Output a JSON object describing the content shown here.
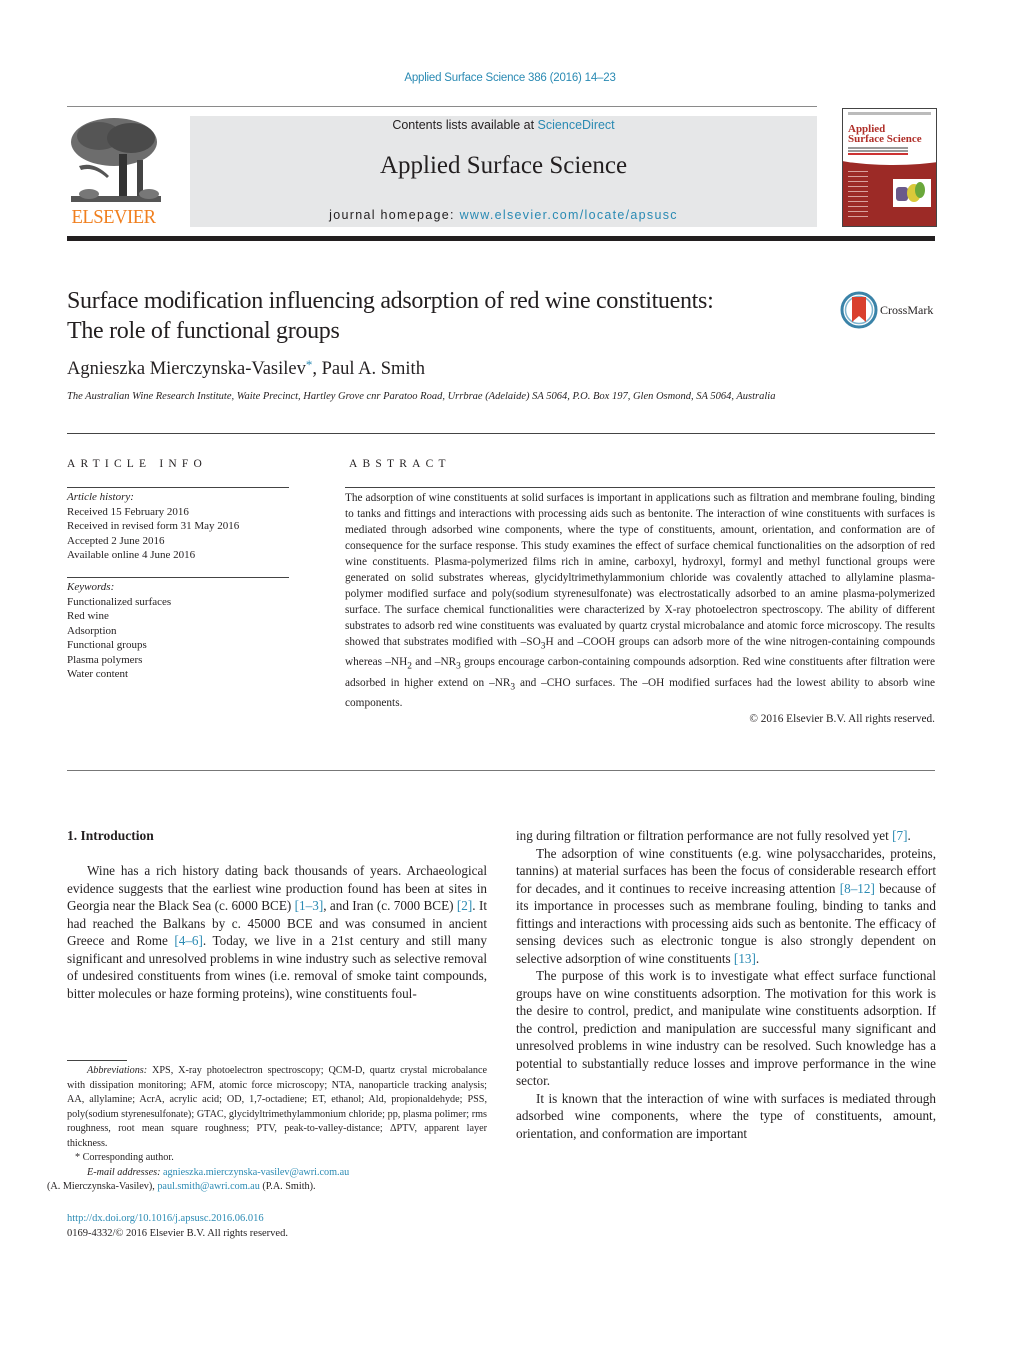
{
  "header": {
    "journal_ref": "Applied Surface Science 386 (2016) 14–23",
    "publisher_logo_text": "ELSEVIER",
    "contents_prefix": "Contents lists available at ",
    "contents_link": "ScienceDirect",
    "journal_title": "Applied Surface Science",
    "homepage_prefix": "journal homepage: ",
    "homepage_link": "www.elsevier.com/locate/apsusc",
    "cover_title_line1": "Applied",
    "cover_title_line2": "Surface Science"
  },
  "article": {
    "title_line1": "Surface modification influencing adsorption of red wine constituents:",
    "title_line2": "The role of functional groups",
    "crossmark_label": "CrossMark",
    "author1": "Agnieszka Mierczynska-Vasilev",
    "author1_mark": "*",
    "author_sep": ", ",
    "author2": "Paul A. Smith",
    "affiliation": "The Australian Wine Research Institute, Waite Precinct, Hartley Grove cnr Paratoo Road, Urrbrae (Adelaide) SA 5064, P.O. Box 197, Glen Osmond, SA 5064, Australia"
  },
  "article_info": {
    "heading": "ARTICLE INFO",
    "history_label": "Article history:",
    "history": [
      "Received 15 February 2016",
      "Received in revised form 31 May 2016",
      "Accepted 2 June 2016",
      "Available online 4 June 2016"
    ],
    "keywords_label": "Keywords:",
    "keywords": [
      "Functionalized surfaces",
      "Red wine",
      "Adsorption",
      "Functional groups",
      "Plasma polymers",
      "Water content"
    ]
  },
  "abstract": {
    "heading": "ABSTRACT",
    "text_part1": "The adsorption of wine constituents at solid surfaces is important in applications such as filtration and membrane fouling, binding to tanks and fittings and interactions with processing aids such as bentonite. The interaction of wine constituents with surfaces is mediated through adsorbed wine components, where the type of constituents, amount, orientation, and conformation are of consequence for the surface response. This study examines the effect of surface chemical functionalities on the adsorption of red wine constituents. Plasma-polymerized films rich in amine, carboxyl, hydroxyl, formyl and methyl functional groups were generated on solid substrates whereas, glycidyltrimethylammonium chloride was covalently attached to allylamine plasma-polymer modified surface and poly(sodium styrenesulfonate) was electrostatically adsorbed to an amine plasma-polymerized surface. The surface chemical functionalities were characterized by X-ray photoelectron spectroscopy. The ability of different substrates to adsorb red wine constituents was evaluated by quartz crystal microbalance and atomic force microscopy. The results showed that substrates modified with ",
    "so3h": "–SO",
    "so3h_sub": "3",
    "so3h_end": "H",
    "text_part2": " and –COOH groups can adsorb more of the wine nitrogen-containing compounds whereas ",
    "nh2": "–NH",
    "nh2_sub": "2",
    "text_part3": " and ",
    "nr3": "–NR",
    "nr3_sub": "3",
    "text_part4": " groups encourage carbon-containing compounds adsorption. Red wine constituents after filtration were adsorbed in higher extend on ",
    "nr3b": "–NR",
    "nr3b_sub": "3",
    "text_part5": " and –CHO surfaces. The –OH modified surfaces had the lowest ability to absorb wine components.",
    "copyright": "© 2016 Elsevier B.V. All rights reserved."
  },
  "introduction": {
    "heading": "1.  Introduction",
    "left_p1_a": "Wine has a rich history dating back thousands of years. Archaeological evidence suggests that the earliest wine production found has been at sites in Georgia near the Black Sea (c. 6000 BCE) ",
    "ref_1_3": "[1–3]",
    "left_p1_b": ", and Iran (c. 7000 BCE) ",
    "ref_2": "[2]",
    "left_p1_c": ". It had reached the Balkans by c. 45000 BCE and was consumed in ancient Greece and Rome ",
    "ref_4_6": "[4–6]",
    "left_p1_d": ". Today, we live in a 21st century and still many significant and unresolved problems in wine industry such as selective removal of undesired constituents from wines (i.e. removal of smoke taint compounds, bitter molecules or haze forming proteins), wine constituents foul-",
    "right_p1_a": "ing during filtration or filtration performance are not fully resolved yet ",
    "ref_7": "[7]",
    "right_p1_b": ".",
    "right_p2_a": "The adsorption of wine constituents (e.g. wine polysaccharides, proteins, tannins) at material surfaces has been the focus of considerable research effort for decades, and it continues to receive increasing attention ",
    "ref_8_12": "[8–12]",
    "right_p2_b": " because of its importance in processes such as membrane fouling, binding to tanks and fittings and interactions with processing aids such as bentonite. The efficacy of sensing devices such as electronic tongue is also strongly dependent on selective adsorption of wine constituents ",
    "ref_13": "[13]",
    "right_p2_c": ".",
    "right_p3": "The purpose of this work is to investigate what effect surface functional groups have on wine constituents adsorption. The motivation for this work is the desire to control, predict, and manipulate wine constituents adsorption. If the control, prediction and manipulation are successful many significant and unresolved problems in wine industry can be resolved. Such knowledge has a potential to substantially reduce losses and improve performance in the wine sector.",
    "right_p4": "It is known that the interaction of wine with surfaces is mediated through adsorbed wine components, where the type of constituents, amount, orientation, and conformation are important"
  },
  "footnotes": {
    "abbrev_label": "Abbreviations:",
    "abbrev_text": " XPS, X-ray photoelectron spectroscopy; QCM-D, quartz crystal microbalance with dissipation monitoring; AFM, atomic force microscopy; NTA, nanoparticle tracking analysis; AA, allylamine; AcrA, acrylic acid; OD, 1,7-octadiene; ET, ethanol; Ald, propionaldehyde; PSS, poly(sodium styrenesulfonate); GTAC, glycidyltrimethylammonium chloride; pp, plasma polimer; rms roughness, root mean square roughness; PTV, peak-to-valley-distance; ΔPTV, apparent layer thickness.",
    "corresponding": "* Corresponding author.",
    "email_label": "E-mail addresses:",
    "email1": "agnieszka.mierczynska-vasilev@awri.com.au",
    "email1_name": " (A. Mierczynska-Vasilev), ",
    "email2": "paul.smith@awri.com.au",
    "email2_name": " (P.A. Smith).",
    "doi": "http://dx.doi.org/10.1016/j.apsusc.2016.06.016",
    "issn": "0169-4332/© 2016 Elsevier B.V. All rights reserved."
  }
}
